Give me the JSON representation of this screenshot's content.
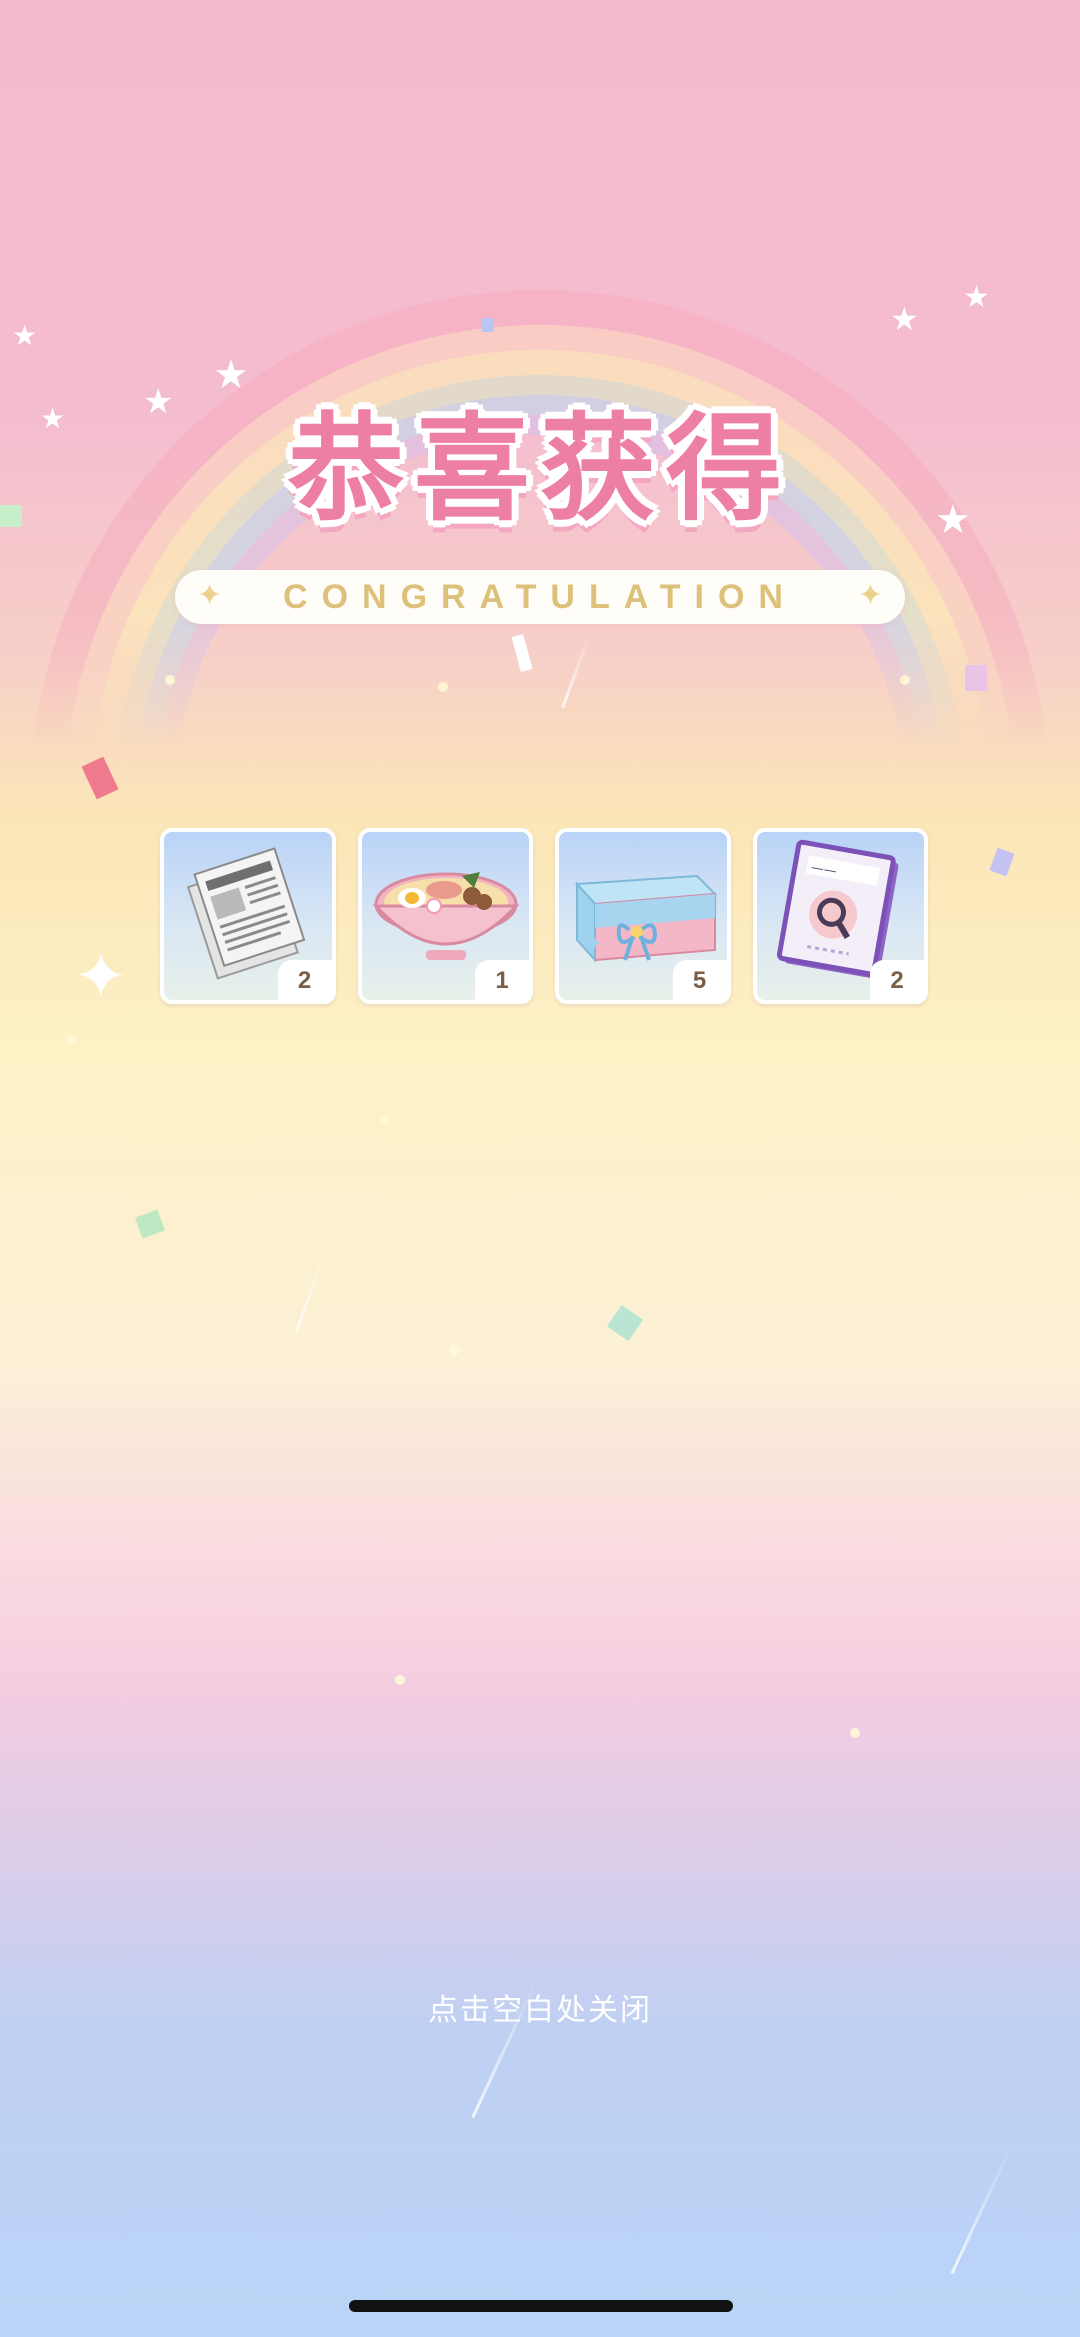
{
  "title": "恭喜获得",
  "subtitle": "CONGRATULATION",
  "rewards": [
    {
      "name": "newspaper",
      "icon": "newspaper-icon",
      "quantity": "2"
    },
    {
      "name": "ramen",
      "icon": "ramen-bowl-icon",
      "quantity": "1"
    },
    {
      "name": "gift-box",
      "icon": "gift-box-icon",
      "quantity": "5"
    },
    {
      "name": "detective-book",
      "icon": "magnifier-book-icon",
      "quantity": "2"
    }
  ],
  "close_hint": "点击空白处关闭",
  "colors": {
    "title": "#ee7fa4",
    "subtitle": "#ddc07a",
    "quantity_text": "#7a5f46"
  }
}
